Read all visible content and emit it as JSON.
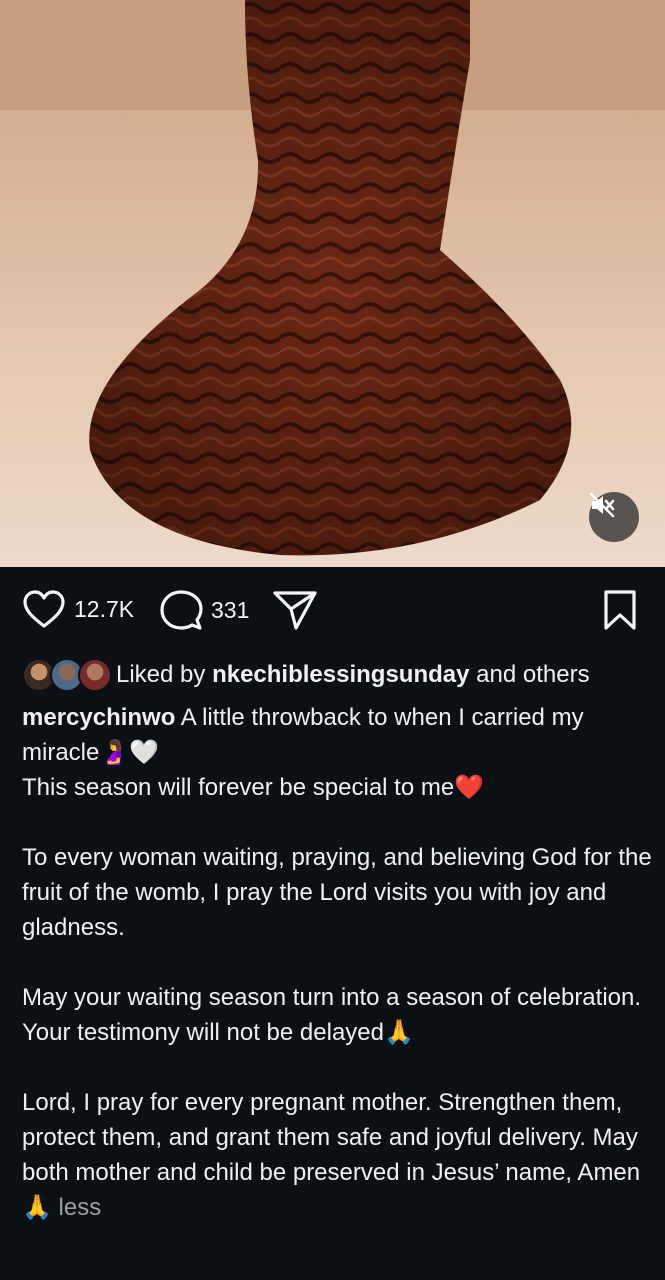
{
  "post": {
    "media": {
      "mute_icon": "muted-speaker-icon",
      "description_colors": {
        "backdrop": "#d8b496",
        "dress": "#6e2a17"
      }
    },
    "actions": {
      "like_count": "12.7K",
      "comment_count": "331",
      "icons": [
        "heart-icon",
        "comment-icon",
        "share-icon",
        "bookmark-icon"
      ]
    },
    "likes": {
      "prefix": "Liked by",
      "user": "nkechiblessingsunday",
      "suffix": "and others"
    },
    "caption": {
      "username": "mercychinwo",
      "line1": " A little throwback to when I carried my miracle🤰🤍",
      "line2": "This season will forever be special to me❤️",
      "para2": "To every woman waiting, praying, and believing God for the fruit of the womb, I pray the Lord visits you with joy and gladness.",
      "para3a": "May your waiting season turn into a season of celebration.",
      "para3b": "Your testimony will not be delayed🙏",
      "para4": "Lord, I pray for every pregnant mother. Strengthen them, protect them, and grant them safe and joyful delivery. May both mother and child be preserved in Jesus’ name, Amen🙏",
      "less_label": " less"
    }
  }
}
